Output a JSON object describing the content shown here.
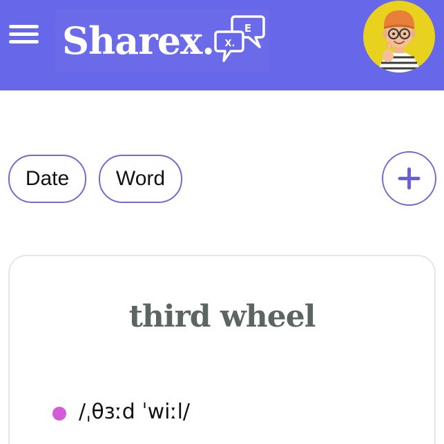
{
  "header": {
    "app_title": "Sharex.",
    "logo_bubble_letters": [
      "X.",
      "E"
    ],
    "background_color": "#6767ea",
    "menu_icon": "hamburger-menu-icon",
    "avatar_icon": "user-avatar-memoji"
  },
  "filters": {
    "chips": [
      {
        "label": "Date"
      },
      {
        "label": "Word"
      }
    ],
    "add_icon": "plus-icon",
    "accent_color": "#7268d4"
  },
  "card": {
    "title": "third wheel",
    "title_color": "#5d6563",
    "phonetic": "/ˌθɜːd ˈwiːl/",
    "bullet_color": "#d55bd8"
  }
}
